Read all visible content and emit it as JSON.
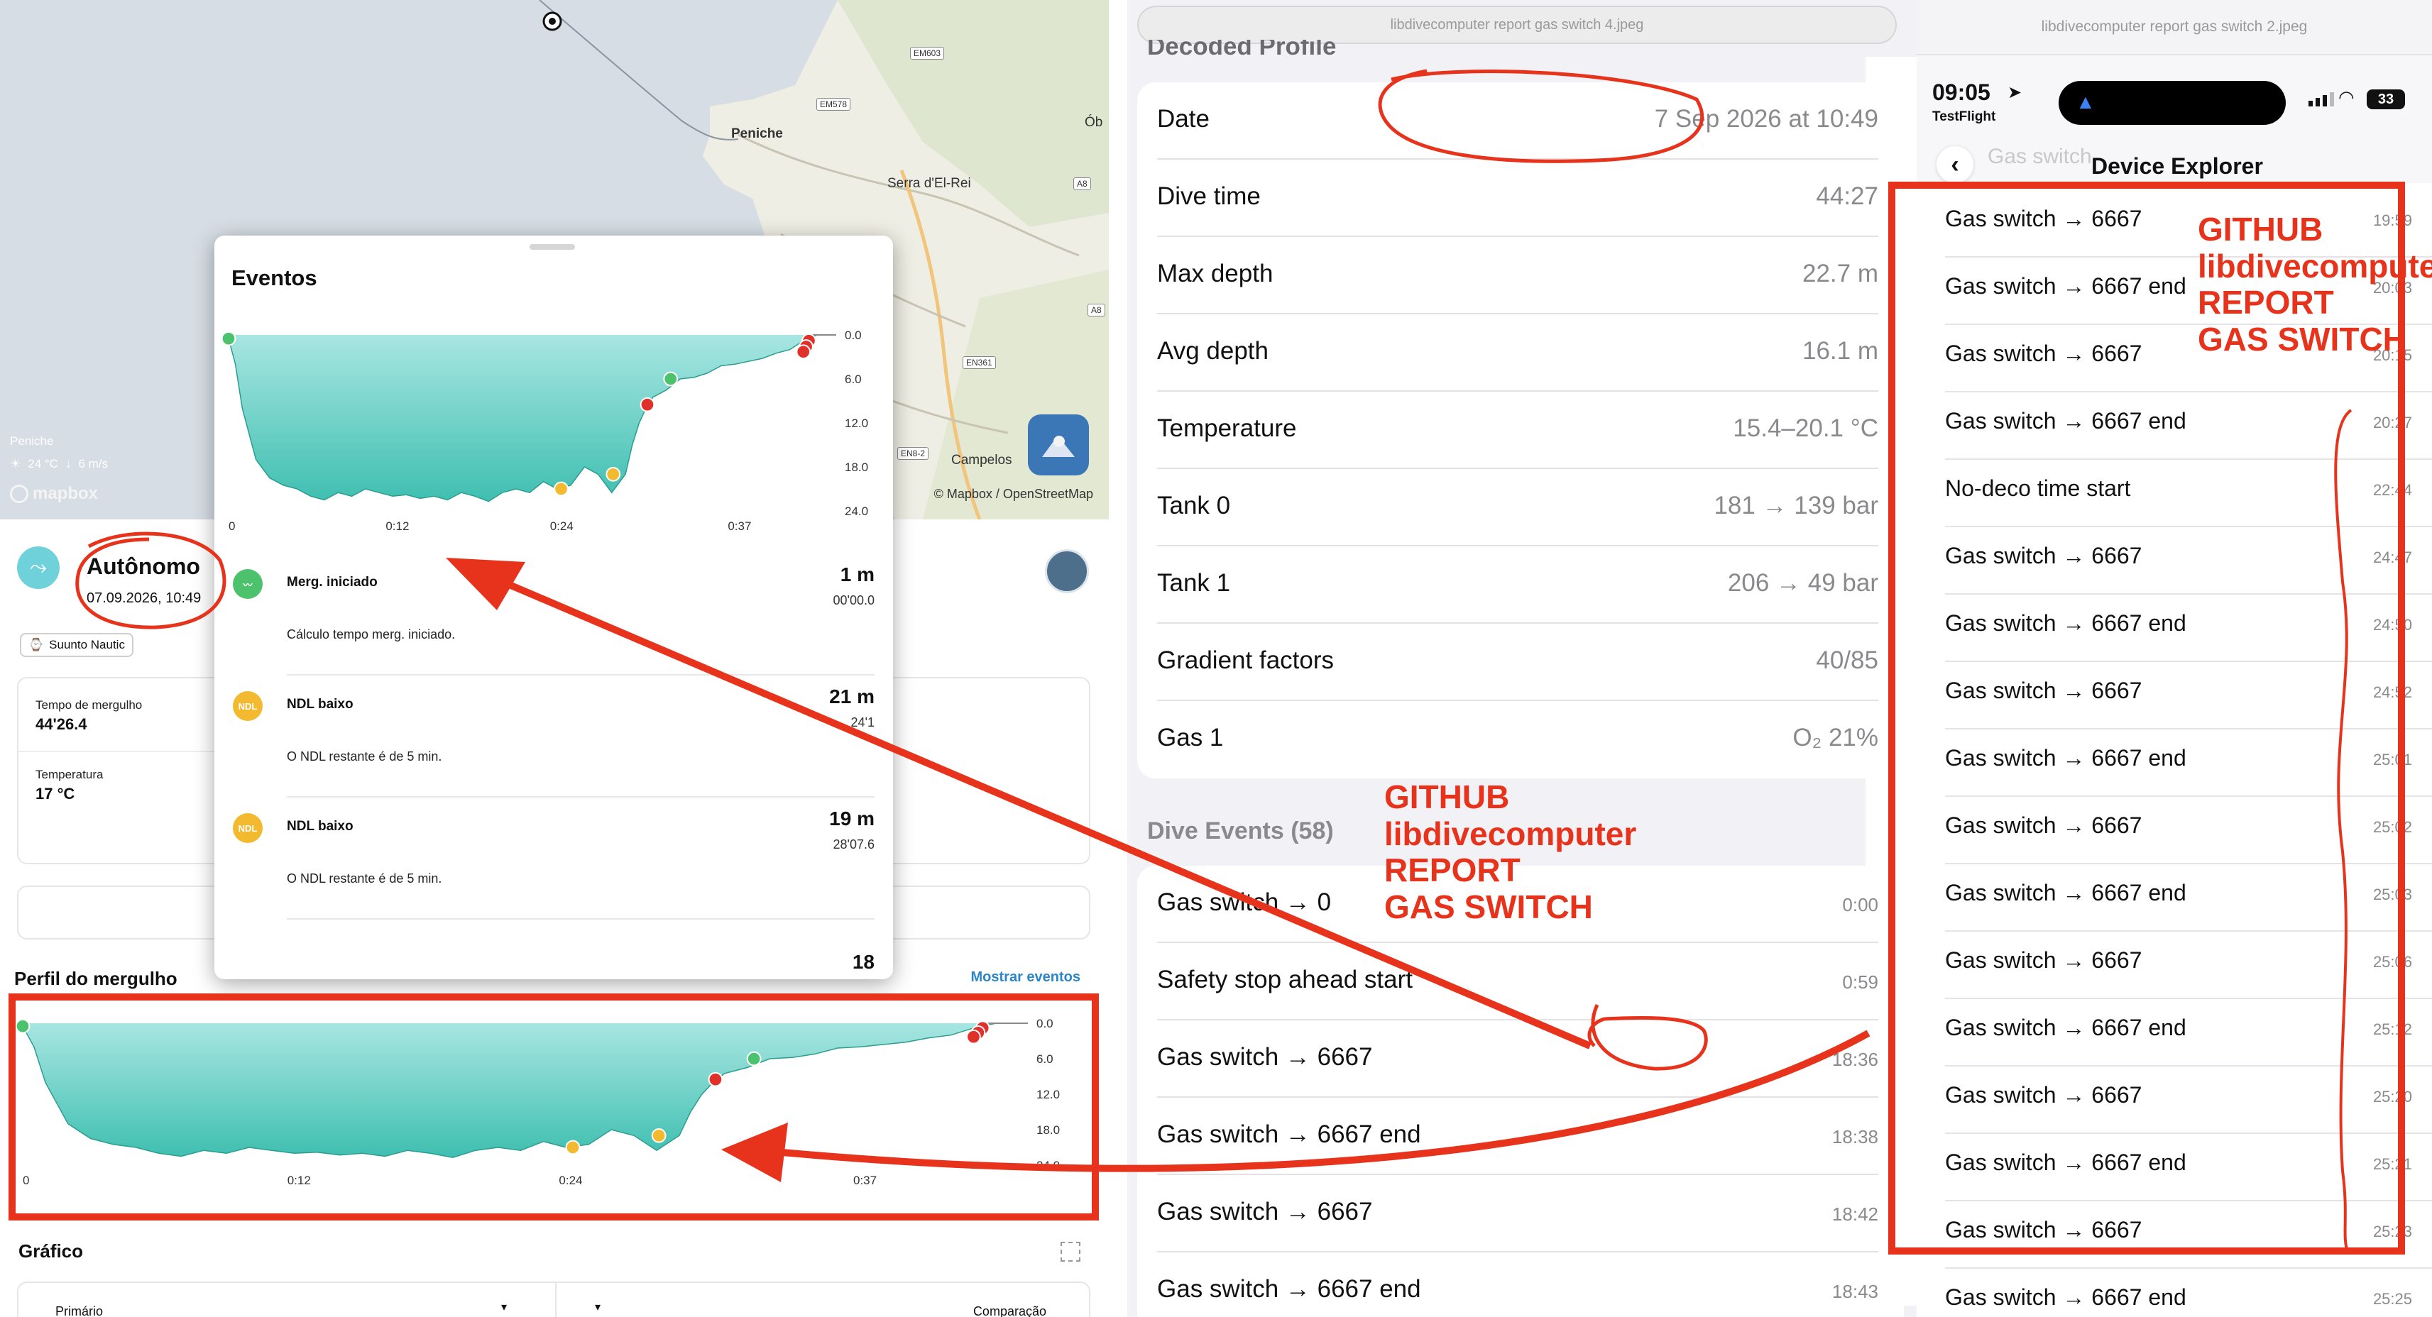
{
  "left": {
    "map": {
      "places": [
        "Peniche",
        "Serra d'El-Rei",
        "Campelos",
        "Ób"
      ],
      "roads": [
        "EM603",
        "EM578",
        "A8",
        "EN361",
        "A8",
        "EN8-2"
      ],
      "weather_place": "Peniche",
      "weather": "24 °C",
      "wind": "6 m/s",
      "mapbox_logo": "mapbox",
      "attribution": "© Mapbox / OpenStreetMap"
    },
    "dive": {
      "title": "Autônomo",
      "datetime": "07.09.2026, 10:49",
      "device": "Suunto Nautic",
      "stats": [
        {
          "label": "Tempo de mergulho",
          "value": "44'26.4"
        },
        {
          "label": "Temperatura",
          "value": "17 °C"
        }
      ],
      "profile_title": "Perfil do mergulho",
      "show_events": "Mostrar eventos",
      "graph_title": "Gráfico",
      "primary_label": "Primário",
      "comparison_label": "Comparação"
    },
    "eventos": {
      "title": "Eventos",
      "events": [
        {
          "icon": "merg-iniciado",
          "title": "Merg. iniciado",
          "desc": "Cálculo tempo merg. iniciado.",
          "depth": "1 m",
          "time": "00'00.0",
          "color": "#4cc26c"
        },
        {
          "icon": "ndl",
          "title": "NDL baixo",
          "desc": "O NDL restante é de 5 min.",
          "depth": "21 m",
          "time": "24'1",
          "color": "#f3b92f"
        },
        {
          "icon": "ndl",
          "title": "NDL baixo",
          "desc": "O NDL restante é de 5 min.",
          "depth": "19 m",
          "time": "28'07.6",
          "color": "#f3b92f"
        }
      ],
      "next_depth": "18",
      "ndl_badge": "NDL"
    }
  },
  "chart_data": [
    {
      "type": "area",
      "title": "",
      "x_ticks": [
        "0",
        "0:12",
        "0:24",
        "0:37"
      ],
      "y_ticks": [
        "0.0",
        "6.0",
        "12.0",
        "18.0",
        "24.0"
      ],
      "y_reversed": true,
      "ylim": [
        0,
        24
      ],
      "xlim": [
        0,
        44.4
      ],
      "series": [
        {
          "x": [
            0,
            0.5,
            1,
            2,
            3,
            4,
            5,
            6,
            7,
            8,
            9,
            10,
            11,
            12,
            13,
            14,
            15,
            16,
            17,
            18,
            19,
            20,
            21,
            22,
            23,
            24,
            25,
            26,
            27,
            28,
            29,
            29.5,
            30,
            30.5,
            31,
            32,
            33,
            34,
            35,
            36,
            37,
            38,
            39,
            40,
            41,
            42,
            42.5,
            43,
            44.4
          ],
          "y": [
            0.5,
            4,
            10,
            17,
            19.5,
            20.5,
            21,
            22,
            22.5,
            21.5,
            22,
            21,
            21.5,
            22,
            21.8,
            22.3,
            22,
            22.5,
            21.5,
            22,
            22.7,
            21.5,
            21,
            21.5,
            20,
            21,
            20.5,
            18,
            19,
            21.5,
            19,
            15,
            12,
            10,
            8.5,
            7.5,
            6,
            5.8,
            5.2,
            4.2,
            4,
            3.6,
            3.2,
            2.5,
            2,
            0.8,
            0.4,
            0,
            0
          ]
        }
      ],
      "markers": [
        {
          "x": 0,
          "y": 0.5,
          "color": "green"
        },
        {
          "x": 24.3,
          "y": 21,
          "color": "yellow"
        },
        {
          "x": 28.1,
          "y": 19,
          "color": "yellow"
        },
        {
          "x": 30.6,
          "y": 9.5,
          "color": "red"
        },
        {
          "x": 32.3,
          "y": 6,
          "color": "green"
        },
        {
          "x": 42.4,
          "y": 0.8,
          "color": "red"
        },
        {
          "x": 42.2,
          "y": 1.6,
          "color": "red"
        },
        {
          "x": 42.0,
          "y": 2.3,
          "color": "red"
        }
      ]
    }
  ],
  "middle": {
    "url": "libdivecomputer report gas switch 4.jpeg",
    "section_title": "Decoded Profile",
    "details": [
      {
        "label": "Date",
        "value": "7 Sep 2026 at 10:49"
      },
      {
        "label": "Dive time",
        "value": "44:27"
      },
      {
        "label": "Max depth",
        "value": "22.7 m"
      },
      {
        "label": "Avg depth",
        "value": "16.1 m"
      },
      {
        "label": "Temperature",
        "value": "15.4–20.1 °C"
      },
      {
        "label": "Tank 0",
        "value": "181 → 139 bar"
      },
      {
        "label": "Tank 1",
        "value": "206 → 49 bar"
      },
      {
        "label": "Gradient factors",
        "value": "40/85"
      },
      {
        "label": "Gas 1",
        "value": "O₂ 21%"
      }
    ],
    "events_title": "Dive Events (58)",
    "events": [
      {
        "label": "Gas switch → 0",
        "time": "0:00"
      },
      {
        "label": "Safety stop ahead start",
        "time": "0:59"
      },
      {
        "label": "Gas switch → 6667",
        "time": "18:36"
      },
      {
        "label": "Gas switch → 6667 end",
        "time": "18:38"
      },
      {
        "label": "Gas switch → 6667",
        "time": "18:42"
      },
      {
        "label": "Gas switch → 6667 end",
        "time": "18:43"
      }
    ]
  },
  "right": {
    "url": "libdivecomputer report gas switch 2.jpeg",
    "status_time": "09:05",
    "testflight": "TestFlight",
    "battery": "33",
    "back_label": "Gas switch",
    "nav_title": "Device Explorer",
    "rows": [
      {
        "label": "Gas switch → 6667",
        "time": "19:59"
      },
      {
        "label": "Gas switch → 6667 end",
        "time": "20:03"
      },
      {
        "label": "Gas switch → 6667",
        "time": "20:15"
      },
      {
        "label": "Gas switch → 6667 end",
        "time": "20:27"
      },
      {
        "label": "No-deco time start",
        "time": "22:44"
      },
      {
        "label": "Gas switch → 6667",
        "time": "24:47"
      },
      {
        "label": "Gas switch → 6667 end",
        "time": "24:50"
      },
      {
        "label": "Gas switch → 6667",
        "time": "24:52"
      },
      {
        "label": "Gas switch → 6667 end",
        "time": "25:01"
      },
      {
        "label": "Gas switch → 6667",
        "time": "25:02"
      },
      {
        "label": "Gas switch → 6667 end",
        "time": "25:03"
      },
      {
        "label": "Gas switch → 6667",
        "time": "25:06"
      },
      {
        "label": "Gas switch → 6667 end",
        "time": "25:12"
      },
      {
        "label": "Gas switch → 6667",
        "time": "25:20"
      },
      {
        "label": "Gas switch → 6667 end",
        "time": "25:21"
      },
      {
        "label": "Gas switch → 6667",
        "time": "25:23"
      },
      {
        "label": "Gas switch → 6667 end",
        "time": "25:25"
      }
    ]
  },
  "annotations": {
    "label_lines": [
      "GITHUB",
      "libdivecomputer",
      "REPORT",
      "GAS SWITCH"
    ],
    "color": "#e8331c"
  }
}
